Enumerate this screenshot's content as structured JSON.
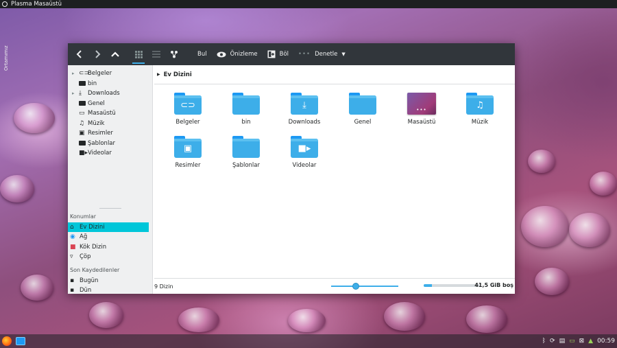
{
  "panel": {
    "title": "Plasma Masaüstü"
  },
  "desktop": {
    "side_label": "Ortamımız"
  },
  "toolbar": {
    "find": "Bul",
    "preview": "Önizleme",
    "split": "Böl",
    "control": "Denetle"
  },
  "tree": {
    "items": [
      "Belgeler",
      "bin",
      "Downloads",
      "Genel",
      "Masaüstü",
      "Müzik",
      "Resimler",
      "Şablonlar",
      "Videolar"
    ]
  },
  "places": {
    "section": "Konumlar",
    "items": [
      "Ev Dizini",
      "Ağ",
      "Kök Dizin",
      "Çöp"
    ],
    "recent_section": "Son Kaydedilenler",
    "recent": [
      "Bugün",
      "Dün"
    ]
  },
  "breadcrumb": {
    "current": "Ev Dizini"
  },
  "files": [
    "Belgeler",
    "bin",
    "Downloads",
    "Genel",
    "Masaüstü",
    "Müzik",
    "Resimler",
    "Şablonlar",
    "Videolar"
  ],
  "status": {
    "count": "9 Dizin",
    "free_space": "41,5 GiB boş",
    "disk_used_fraction": 0.15
  },
  "taskbar": {
    "clock": "00:59"
  },
  "colors": {
    "accent": "#3daee9",
    "selection": "#00c6d9",
    "toolbar": "#31363b"
  }
}
